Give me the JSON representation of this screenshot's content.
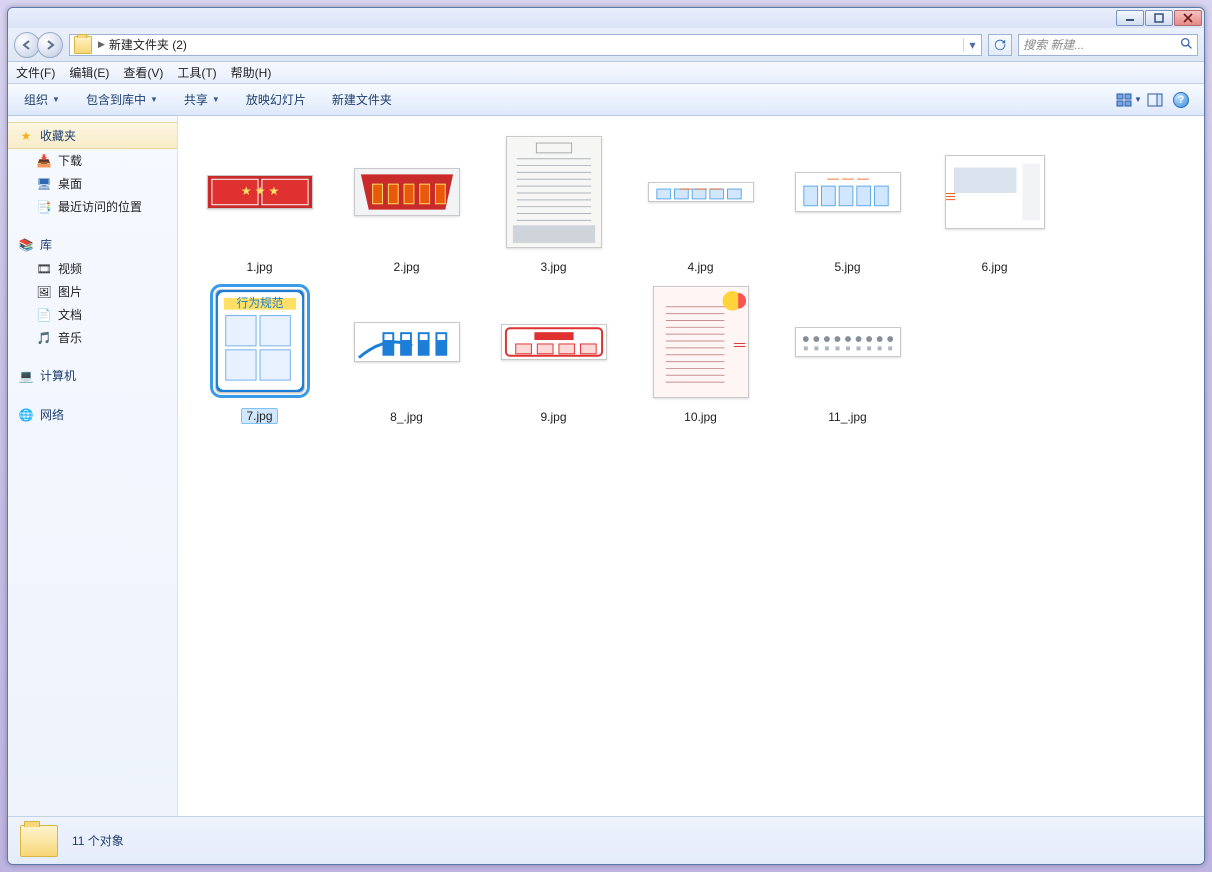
{
  "address": {
    "path_label": "新建文件夹 (2)",
    "search_placeholder": "搜索 新建..."
  },
  "menubar": {
    "file": "文件(F)",
    "edit": "编辑(E)",
    "view": "查看(V)",
    "tools": "工具(T)",
    "help": "帮助(H)"
  },
  "toolbar": {
    "organize": "组织",
    "include": "包含到库中",
    "share": "共享",
    "slideshow": "放映幻灯片",
    "newfolder": "新建文件夹"
  },
  "sidebar": {
    "favorites": {
      "header": "收藏夹",
      "downloads": "下载",
      "desktop": "桌面",
      "recent": "最近访问的位置"
    },
    "libraries": {
      "header": "库",
      "video": "视频",
      "pictures": "图片",
      "documents": "文档",
      "music": "音乐"
    },
    "computer": "计算机",
    "network": "网络"
  },
  "files": [
    {
      "name": "1.jpg",
      "selected": false,
      "w": 106,
      "h": 34,
      "style": "red"
    },
    {
      "name": "2.jpg",
      "selected": false,
      "w": 106,
      "h": 48,
      "style": "redbanner"
    },
    {
      "name": "3.jpg",
      "selected": false,
      "w": 96,
      "h": 112,
      "style": "greytext"
    },
    {
      "name": "4.jpg",
      "selected": false,
      "w": 106,
      "h": 20,
      "style": "bluebars"
    },
    {
      "name": "5.jpg",
      "selected": false,
      "w": 106,
      "h": 40,
      "style": "bluebars"
    },
    {
      "name": "6.jpg",
      "selected": false,
      "w": 100,
      "h": 74,
      "style": "photo"
    },
    {
      "name": "7.jpg",
      "selected": true,
      "w": 90,
      "h": 104,
      "style": "blueboard"
    },
    {
      "name": "8_.jpg",
      "selected": false,
      "w": 106,
      "h": 40,
      "style": "bluemachines"
    },
    {
      "name": "9.jpg",
      "selected": false,
      "w": 106,
      "h": 36,
      "style": "redoutline"
    },
    {
      "name": "10.jpg",
      "selected": false,
      "w": 96,
      "h": 112,
      "style": "pinktext"
    },
    {
      "name": "11_.jpg",
      "selected": false,
      "w": 106,
      "h": 30,
      "style": "icons"
    }
  ],
  "statusbar": {
    "count_text": "11 个对象"
  }
}
